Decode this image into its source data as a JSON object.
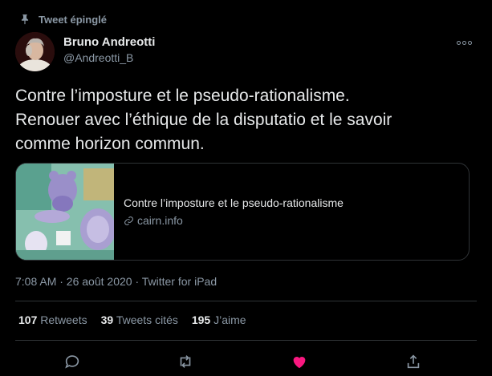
{
  "pinned": {
    "label": "Tweet épinglé",
    "icon": "pin-icon"
  },
  "author": {
    "name": "Bruno Andreotti",
    "handle": "@Andreotti_B"
  },
  "tweet": {
    "lines": [
      "Contre l’imposture et le pseudo-rationalisme.",
      "Renouer avec l’éthique de la disputatio et le savoir",
      "comme horizon commun."
    ]
  },
  "card": {
    "title": "Contre l’imposture et le pseudo-rationalisme",
    "domain": "cairn.info",
    "link_icon": "link-icon"
  },
  "meta": {
    "text": "7:08 AM · 26 août 2020 · Twitter for iPad"
  },
  "stats": [
    {
      "count": "107",
      "label": "Retweets"
    },
    {
      "count": "39",
      "label": "Tweets cités"
    },
    {
      "count": "195",
      "label": "J’aime"
    }
  ],
  "actions": [
    {
      "name": "reply",
      "icon": "reply-icon"
    },
    {
      "name": "retweet",
      "icon": "retweet-icon"
    },
    {
      "name": "like",
      "icon": "heart-icon",
      "active": true
    },
    {
      "name": "share",
      "icon": "share-icon"
    }
  ],
  "colors": {
    "like_active": "#f91880",
    "secondary_text": "#8b98a5",
    "divider": "#2f3336"
  }
}
